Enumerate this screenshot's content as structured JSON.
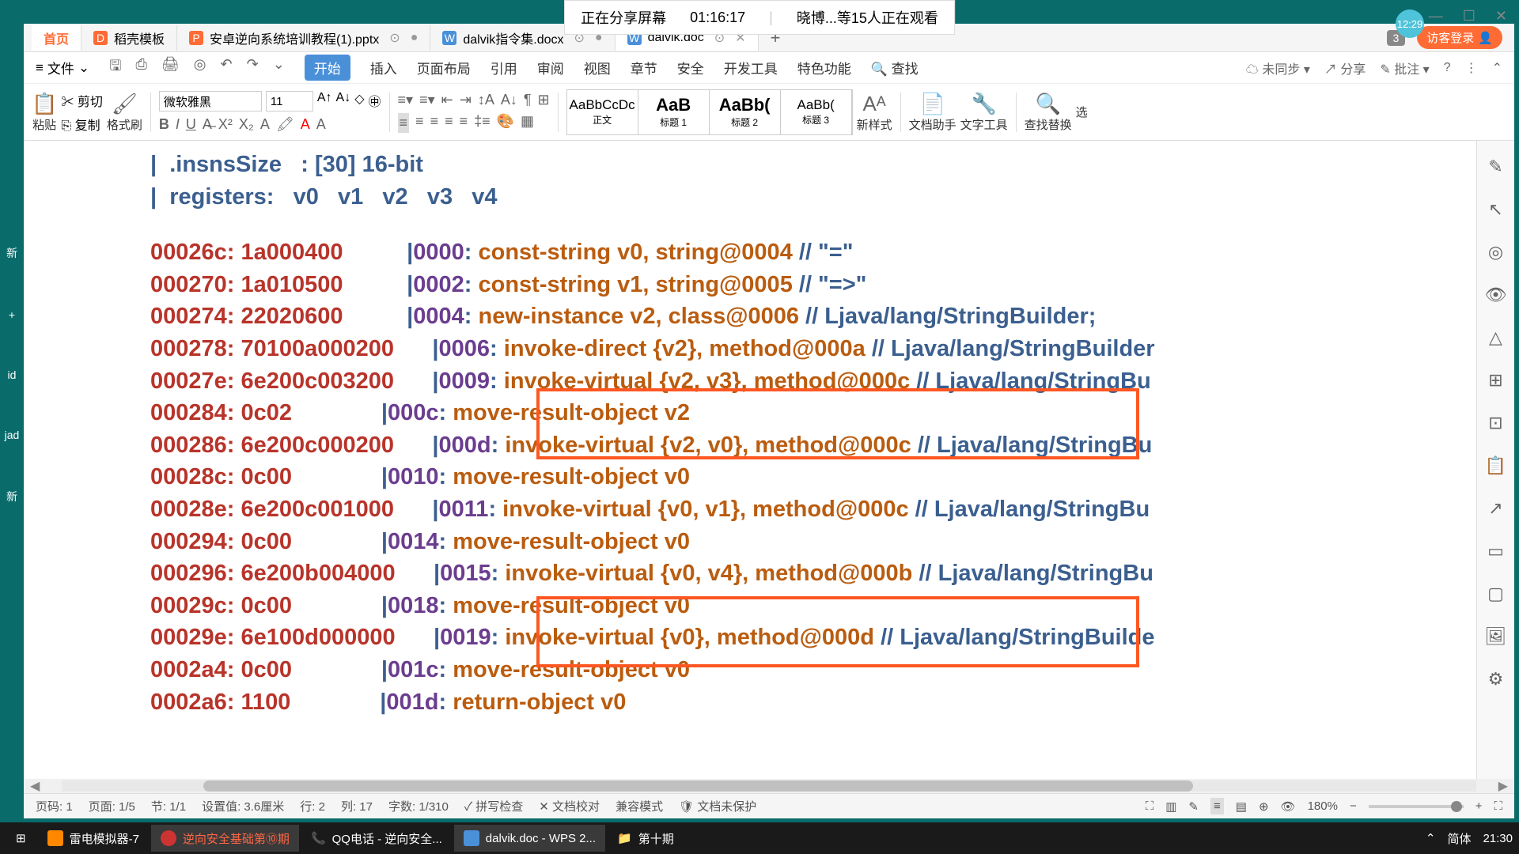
{
  "share_bar": {
    "sharing_text": "正在分享屏幕",
    "duration": "01:16:17",
    "viewers": "晓博...等15人正在观看"
  },
  "time_badge": "12:29",
  "tabs": {
    "home": "首页",
    "items": [
      {
        "icon": "D",
        "label": "稻壳模板"
      },
      {
        "icon": "P",
        "label": "安卓逆向系统培训教程(1).pptx"
      },
      {
        "icon": "W",
        "label": "dalvik指令集.docx"
      },
      {
        "icon": "W",
        "label": "dalvik.doc"
      }
    ],
    "notif_count": "3",
    "login": "访客登录"
  },
  "menu": {
    "file": "文件",
    "items": [
      "开始",
      "插入",
      "页面布局",
      "引用",
      "审阅",
      "视图",
      "章节",
      "安全",
      "开发工具",
      "特色功能"
    ],
    "search": "查找",
    "sync": "未同步",
    "share": "分享",
    "approve": "批注"
  },
  "ribbon": {
    "paste": "粘贴",
    "cut": "剪切",
    "copy": "复制",
    "format_painter": "格式刷",
    "font_name": "微软雅黑",
    "font_size": "11",
    "styles": [
      {
        "preview": "AaBbCcDc",
        "name": "正文"
      },
      {
        "preview": "AaB",
        "name": "标题 1"
      },
      {
        "preview": "AaBb(",
        "name": "标题 2"
      },
      {
        "preview": "AaBb(",
        "name": "标题 3"
      }
    ],
    "new_style": "新样式",
    "doc_assist": "文档助手",
    "text_tools": "文字工具",
    "find_replace": "查找替换",
    "select": "选"
  },
  "code": {
    "header1": "|  .insnsSize   : [30] 16-bit",
    "header2": "|  registers:   v0   v1   v2   v3   v4",
    "lines": [
      {
        "addr": "00026c:",
        "hex": "1a000400",
        "off": "|0000:",
        "instr": "const-string v0, string@0004",
        "cmt": " // \"=\""
      },
      {
        "addr": "000270:",
        "hex": "1a010500",
        "off": "|0002:",
        "instr": "const-string v1, string@0005",
        "cmt": " // \"=>\""
      },
      {
        "addr": "000274:",
        "hex": "22020600",
        "off": "|0004:",
        "instr": "new-instance v2, class@0006",
        "cmt": " // Ljava/lang/StringBuilder;"
      },
      {
        "addr": "000278:",
        "hex": "70100a000200",
        "off": "|0006:",
        "instr": "invoke-direct {v2}, method@000a",
        "cmt": " // Ljava/lang/StringBuilder"
      },
      {
        "addr": "00027e:",
        "hex": "6e200c003200",
        "off": "|0009:",
        "instr": "invoke-virtual {v2, v3}, method@000c",
        "cmt": " // Ljava/lang/StringBu"
      },
      {
        "addr": "000284:",
        "hex": "0c02",
        "off": "|000c:",
        "instr": "move-result-object v2",
        "cmt": ""
      },
      {
        "addr": "000286:",
        "hex": "6e200c000200",
        "off": "|000d:",
        "instr": "invoke-virtual {v2, v0}, method@000c",
        "cmt": " // Ljava/lang/StringBu"
      },
      {
        "addr": "00028c:",
        "hex": "0c00",
        "off": "|0010:",
        "instr": "move-result-object v0",
        "cmt": ""
      },
      {
        "addr": "00028e:",
        "hex": "6e200c001000",
        "off": "|0011:",
        "instr": "invoke-virtual {v0, v1}, method@000c",
        "cmt": " // Ljava/lang/StringBu"
      },
      {
        "addr": "000294:",
        "hex": "0c00",
        "off": "|0014:",
        "instr": "move-result-object v0",
        "cmt": ""
      },
      {
        "addr": "000296:",
        "hex": "6e200b004000",
        "off": "|0015:",
        "instr": "invoke-virtual {v0, v4}, method@000b",
        "cmt": " // Ljava/lang/StringBu"
      },
      {
        "addr": "00029c:",
        "hex": "0c00",
        "off": "|0018:",
        "instr": "move-result-object v0",
        "cmt": ""
      },
      {
        "addr": "00029e:",
        "hex": "6e100d000000",
        "off": "|0019:",
        "instr": "invoke-virtual {v0}, method@000d",
        "cmt": " // Ljava/lang/StringBuilde"
      },
      {
        "addr": "0002a4:",
        "hex": "0c00",
        "off": "|001c:",
        "instr": "move-result-object v0",
        "cmt": ""
      },
      {
        "addr": "0002a6:",
        "hex": "1100",
        "off": "|001d:",
        "instr": "return-object v0",
        "cmt": ""
      }
    ]
  },
  "status": {
    "page_no": "页码: 1",
    "pages": "页面: 1/5",
    "section": "节: 1/1",
    "position": "设置值: 3.6厘米",
    "line": "行: 2",
    "col": "列: 17",
    "chars": "字数: 1/310",
    "spell": "拼写检查",
    "proof": "文档校对",
    "compat": "兼容模式",
    "protect": "文档未保护",
    "zoom": "180%"
  },
  "taskbar": {
    "items": [
      {
        "label": "雷电模拟器-7"
      },
      {
        "label": "逆向安全基础第⑩期"
      },
      {
        "label": "QQ电话 - 逆向安全..."
      },
      {
        "label": "dalvik.doc - WPS 2..."
      },
      {
        "label": "第十期"
      }
    ],
    "ime": "简体",
    "time": "21:30"
  },
  "left_icons": [
    "新",
    "+",
    "id",
    "jad",
    "新"
  ]
}
